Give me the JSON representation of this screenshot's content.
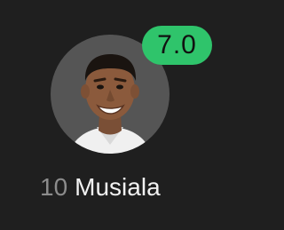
{
  "player": {
    "number": "10",
    "name": "Musiala",
    "rating": "7.0",
    "avatar_icon": "player-photo"
  },
  "colors": {
    "background": "#1f1f1f",
    "avatar_bg": "#555555",
    "rating_badge": "#2fc46b",
    "number_text": "#8c8c8c",
    "name_text": "#f2f2f2"
  }
}
